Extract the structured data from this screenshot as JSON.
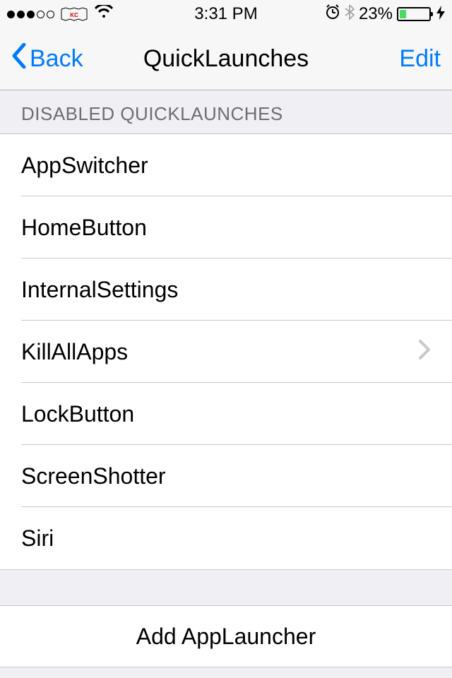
{
  "status": {
    "time": "3:31 PM",
    "battery_pct": "23%"
  },
  "nav": {
    "back_label": "Back",
    "title": "QuickLaunches",
    "edit_label": "Edit"
  },
  "section": {
    "header": "DISABLED QUICKLAUNCHES",
    "items": [
      {
        "label": "AppSwitcher",
        "disclosure": false
      },
      {
        "label": "HomeButton",
        "disclosure": false
      },
      {
        "label": "InternalSettings",
        "disclosure": false
      },
      {
        "label": "KillAllApps",
        "disclosure": true
      },
      {
        "label": "LockButton",
        "disclosure": false
      },
      {
        "label": "ScreenShotter",
        "disclosure": false
      },
      {
        "label": "Siri",
        "disclosure": false
      }
    ]
  },
  "add_button": "Add AppLauncher"
}
